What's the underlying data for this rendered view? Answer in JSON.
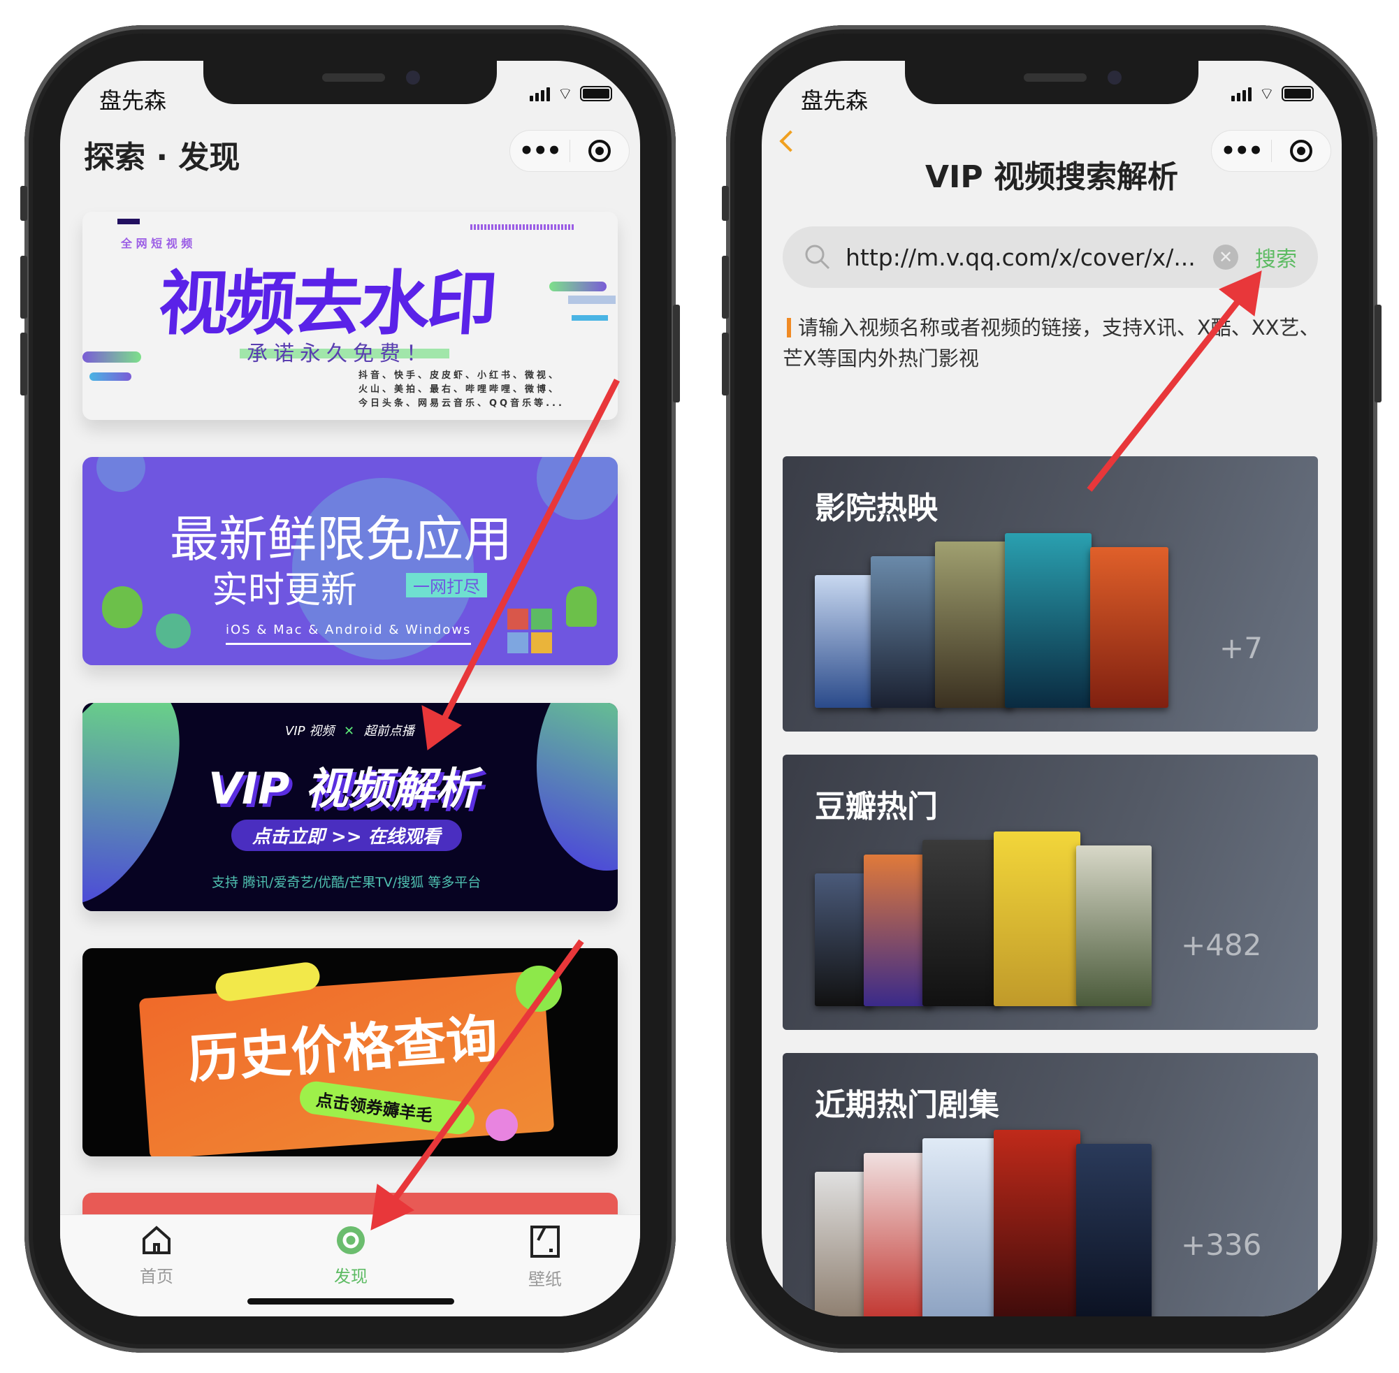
{
  "left_phone": {
    "status_bar": {
      "carrier": "盘先森"
    },
    "header": {
      "title": "探索 · 发现",
      "more_icon": "more-dots-icon",
      "close_icon": "record-circle-icon"
    },
    "banners": [
      {
        "tag": "全 网 短 视 频",
        "title": "视频去水印",
        "subtitle": "承诺永久免费！",
        "platforms": [
          "抖音、快手、皮皮虾、小红书、微视、",
          "火山、美拍、最右、哔哩哔哩、微博、",
          "今日头条、网易云音乐、QQ音乐等..."
        ]
      },
      {
        "title": "最新鲜限免应用",
        "subtitle": "实时更新",
        "badge": "一网打尽",
        "platforms": "iOS & Mac & Android & Windows"
      },
      {
        "tag_left": "VIP 视频",
        "tag_x": "✕",
        "tag_right": "超前点播",
        "title": "VIP 视频解析",
        "button": "点击立即  >> 在线观看",
        "support": "支持 腾讯/爱奇艺/优酷/芒果TV/搜狐 等多平台"
      },
      {
        "title": "历史价格查询",
        "button": "点击领券薅羊毛"
      },
      {}
    ],
    "tabbar": [
      {
        "label": "首页",
        "icon": "home-icon",
        "active": false
      },
      {
        "label": "发现",
        "icon": "discover-icon",
        "active": true
      },
      {
        "label": "壁纸",
        "icon": "wallpaper-icon",
        "active": false
      }
    ]
  },
  "right_phone": {
    "status_bar": {
      "carrier": "盘先森"
    },
    "header": {
      "title": "VIP 视频搜索解析",
      "back_icon": "chevron-left-icon"
    },
    "search": {
      "value": "http://m.v.qq.com/x/cover/x/...",
      "button": "搜索"
    },
    "hint": "请输入视频名称或者视频的链接，支持X讯、X酷、XX艺、芒X等国内外热门影视",
    "sections": [
      {
        "title": "影院热映",
        "more_count": "+7"
      },
      {
        "title": "豆瓣热门",
        "more_count": "+482"
      },
      {
        "title": "近期热门剧集",
        "more_count": "+336"
      }
    ]
  },
  "colors": {
    "accent": "#5dbb63",
    "arrow": "#e8373a",
    "hint_bar": "#f08a24"
  }
}
